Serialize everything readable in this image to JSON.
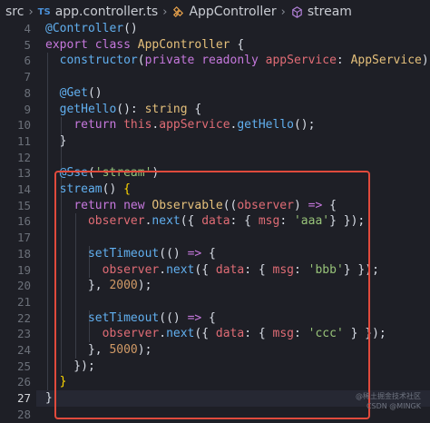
{
  "breadcrumb": {
    "folder": "src",
    "lang_badge": "TS",
    "file": "app.controller.ts",
    "class_name": "AppController",
    "method_name": "stream"
  },
  "line_numbers": [
    "4",
    "5",
    "6",
    "7",
    "8",
    "9",
    "10",
    "11",
    "12",
    "13",
    "14",
    "15",
    "16",
    "17",
    "18",
    "19",
    "20",
    "21",
    "22",
    "23",
    "24",
    "25",
    "26",
    "27",
    "28"
  ],
  "active_line": "27",
  "code": [
    [
      [
        "dec",
        "@Controller"
      ],
      [
        "pl",
        "()"
      ]
    ],
    [
      [
        "kw",
        "export class "
      ],
      [
        "tp",
        "AppController "
      ],
      [
        "pl",
        "{"
      ]
    ],
    [
      [
        "pl",
        "  "
      ],
      [
        "fn",
        "constructor"
      ],
      [
        "pl",
        "("
      ],
      [
        "kw",
        "private readonly "
      ],
      [
        "prop",
        "appService"
      ],
      [
        "pl",
        ": "
      ],
      [
        "tp",
        "AppService"
      ],
      [
        "pl",
        ") {}"
      ]
    ],
    [],
    [
      [
        "pl",
        "  "
      ],
      [
        "dec",
        "@Get"
      ],
      [
        "pl",
        "()"
      ]
    ],
    [
      [
        "pl",
        "  "
      ],
      [
        "fn",
        "getHello"
      ],
      [
        "pl",
        "(): "
      ],
      [
        "tp",
        "string "
      ],
      [
        "pl",
        "{"
      ]
    ],
    [
      [
        "pl",
        "    "
      ],
      [
        "kw",
        "return "
      ],
      [
        "prop",
        "this"
      ],
      [
        "pl",
        "."
      ],
      [
        "prop",
        "appService"
      ],
      [
        "pl",
        "."
      ],
      [
        "fn",
        "getHello"
      ],
      [
        "pl",
        "();"
      ]
    ],
    [
      [
        "pl",
        "  }"
      ]
    ],
    [],
    [
      [
        "pl",
        "  "
      ],
      [
        "dec",
        "@Sse"
      ],
      [
        "pl",
        "("
      ],
      [
        "str",
        "'stream'"
      ],
      [
        "pl",
        ")"
      ]
    ],
    [
      [
        "pl",
        "  "
      ],
      [
        "fn",
        "stream"
      ],
      [
        "pl",
        "() "
      ],
      [
        "br",
        "{"
      ]
    ],
    [
      [
        "pl",
        "    "
      ],
      [
        "kw",
        "return new "
      ],
      [
        "tp",
        "Observable"
      ],
      [
        "pl",
        "(("
      ],
      [
        "prop",
        "observer"
      ],
      [
        "pl",
        ") "
      ],
      [
        "kw",
        "=> "
      ],
      [
        "pl",
        "{"
      ]
    ],
    [
      [
        "pl",
        "      "
      ],
      [
        "prop",
        "observer"
      ],
      [
        "pl",
        "."
      ],
      [
        "fn",
        "next"
      ],
      [
        "pl",
        "({ "
      ],
      [
        "prop",
        "data"
      ],
      [
        "pl",
        ": { "
      ],
      [
        "prop",
        "msg"
      ],
      [
        "pl",
        ": "
      ],
      [
        "str",
        "'aaa'"
      ],
      [
        "pl",
        "} });"
      ]
    ],
    [],
    [
      [
        "pl",
        "      "
      ],
      [
        "fn",
        "setTimeout"
      ],
      [
        "pl",
        "(() "
      ],
      [
        "kw",
        "=> "
      ],
      [
        "pl",
        "{"
      ]
    ],
    [
      [
        "pl",
        "        "
      ],
      [
        "prop",
        "observer"
      ],
      [
        "pl",
        "."
      ],
      [
        "fn",
        "next"
      ],
      [
        "pl",
        "({ "
      ],
      [
        "prop",
        "data"
      ],
      [
        "pl",
        ": { "
      ],
      [
        "prop",
        "msg"
      ],
      [
        "pl",
        ": "
      ],
      [
        "str",
        "'bbb'"
      ],
      [
        "pl",
        "} });"
      ]
    ],
    [
      [
        "pl",
        "      }, "
      ],
      [
        "num",
        "2000"
      ],
      [
        "pl",
        ");"
      ]
    ],
    [],
    [
      [
        "pl",
        "      "
      ],
      [
        "fn",
        "setTimeout"
      ],
      [
        "pl",
        "(() "
      ],
      [
        "kw",
        "=> "
      ],
      [
        "pl",
        "{"
      ]
    ],
    [
      [
        "pl",
        "        "
      ],
      [
        "prop",
        "observer"
      ],
      [
        "pl",
        "."
      ],
      [
        "fn",
        "next"
      ],
      [
        "pl",
        "({ "
      ],
      [
        "prop",
        "data"
      ],
      [
        "pl",
        ": { "
      ],
      [
        "prop",
        "msg"
      ],
      [
        "pl",
        ": "
      ],
      [
        "str",
        "'ccc'"
      ],
      [
        "pl",
        " } });"
      ]
    ],
    [
      [
        "pl",
        "      }, "
      ],
      [
        "num",
        "5000"
      ],
      [
        "pl",
        ");"
      ]
    ],
    [
      [
        "pl",
        "    });"
      ]
    ],
    [
      [
        "pl",
        "  "
      ],
      [
        "br",
        "}"
      ]
    ],
    [
      [
        "pl",
        "}"
      ]
    ],
    []
  ],
  "watermark": {
    "line1": "@稀土掘金技术社区",
    "line2": "CSDN @MINGK"
  },
  "colors": {
    "background": "#1e1f26",
    "highlight_border": "#e04a3c",
    "keyword": "#c678dd",
    "type": "#e5c07b",
    "function": "#61afef",
    "string": "#98c379",
    "number": "#d19a66",
    "property": "#e06c75"
  },
  "icons": {
    "chevron": "chevron-right-icon",
    "class_symbol": "class-symbol-icon",
    "method_symbol": "method-symbol-icon"
  }
}
